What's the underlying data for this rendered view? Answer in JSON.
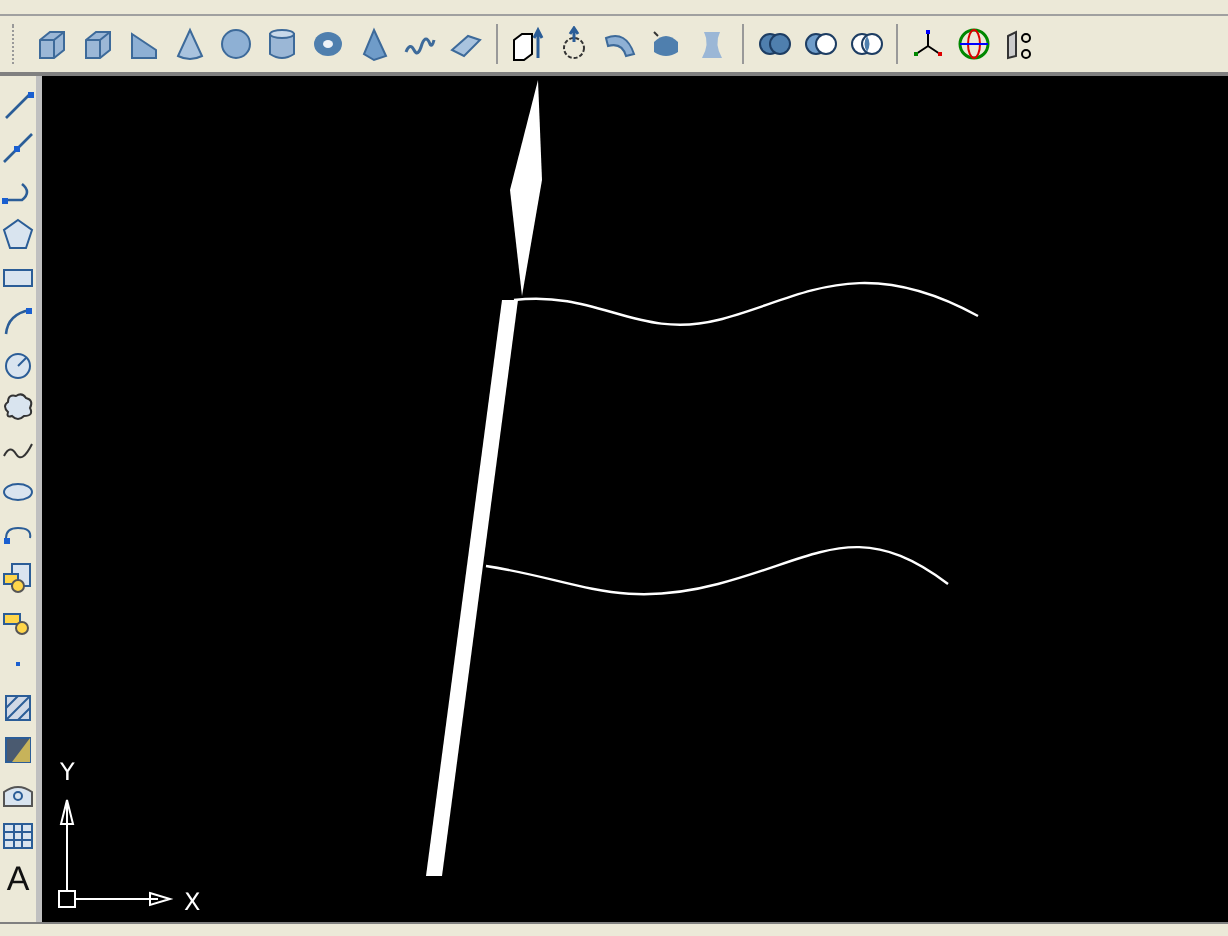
{
  "draw_toolbar": {
    "text_tool_glyph": "A"
  },
  "ucs_icon": {
    "x_label": "X",
    "y_label": "Y"
  }
}
